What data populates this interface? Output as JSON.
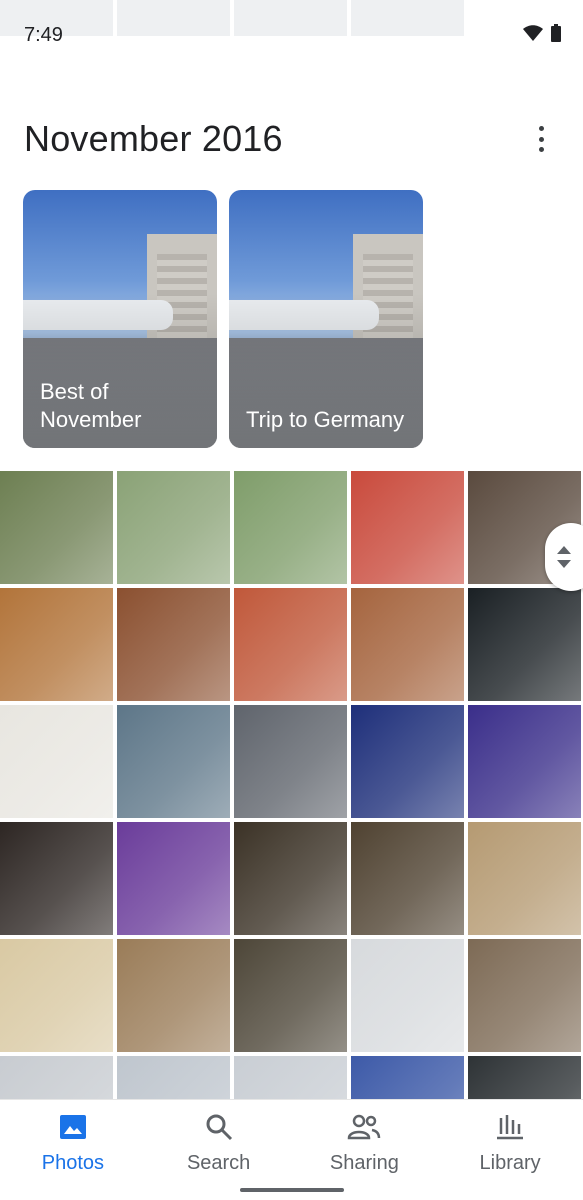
{
  "status_bar": {
    "time": "7:49",
    "wifi_icon": "wifi-icon",
    "battery_icon": "battery-icon"
  },
  "header": {
    "title": "November 2016",
    "more_icon": "more-vert-icon"
  },
  "cards": [
    {
      "label": "Best of November"
    },
    {
      "label": "Trip to Germany"
    }
  ],
  "photos": [
    "#6d7f52",
    "#8aa276",
    "#7f9d6a",
    "#c94a3c",
    "#5a4a3e",
    "#b2743a",
    "#8b5030",
    "#c0583a",
    "#a5643e",
    "#1a2024",
    "#e8e6e0",
    "#5d7688",
    "#5f646c",
    "#1e2f7a",
    "#3a2e8a",
    "#2d2623",
    "#6a3c9a",
    "#3b3226",
    "#4f4231",
    "#b59a72",
    "#d9c9a3",
    "#9a7c58",
    "#4d4638",
    "#d7dadd",
    "#7d6a55",
    "#c8ccd1",
    "#bfc6ce",
    "#c9ced4",
    "#3d5aa8",
    "#2e3336"
  ],
  "nav": {
    "items": [
      {
        "label": "Photos",
        "icon": "photos-icon",
        "active": true
      },
      {
        "label": "Search",
        "icon": "search-icon",
        "active": false
      },
      {
        "label": "Sharing",
        "icon": "sharing-icon",
        "active": false
      },
      {
        "label": "Library",
        "icon": "library-icon",
        "active": false
      }
    ]
  },
  "colors": {
    "accent": "#1a73e8",
    "icon_gray": "#5f6368"
  }
}
